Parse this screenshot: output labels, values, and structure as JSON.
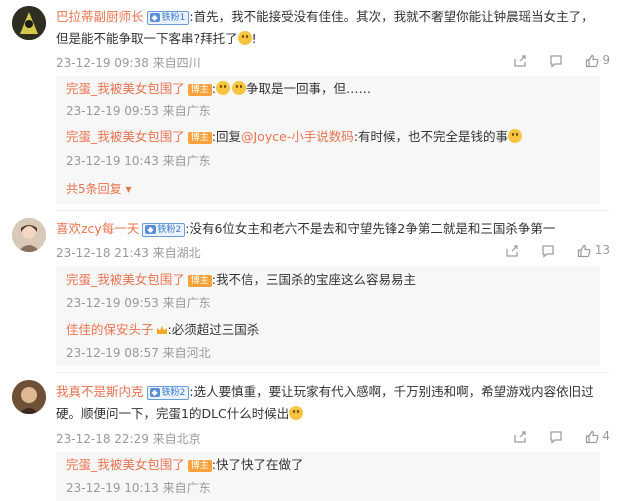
{
  "comments": [
    {
      "user": "巴拉蒂副厨师长",
      "badge": "铁粉1",
      "text": ":首先，我不能接受没有佳佳。其次，我就不奢望你能让钟晨瑶当女主了，",
      "text2": "但是能不能争取一下客串?拜托了",
      "text2_end": "!",
      "meta": "23-12-19 09:38 来自四川",
      "likes": "9",
      "replies": [
        {
          "user": "完蛋_我被美女包围了",
          "badge": "博主",
          "text_pre": ":",
          "text": "争取是一回事，但……",
          "meta": "23-12-19 09:53 来自广东"
        },
        {
          "user": "完蛋_我被美女包围了",
          "badge": "博主",
          "text_pre": ":回复",
          "mention": "@Joyce-小手说数码",
          "text": ":有时候，也不完全是钱的事",
          "meta": "23-12-19 10:43 来自广东"
        }
      ],
      "more": "共5条回复"
    },
    {
      "user": "喜欢zcy每一天",
      "badge": "铁粉2",
      "text": ":没有6位女主和老六不是去和守望先锋2争第二就是和三国杀争第一",
      "meta": "23-12-18 21:43 来自湖北",
      "likes": "13",
      "replies": [
        {
          "user": "完蛋_我被美女包围了",
          "badge": "博主",
          "text": ":我不信，三国杀的宝座这么容易易主",
          "meta": "23-12-19 09:53 来自广东"
        },
        {
          "user": "佳佳的保安头子",
          "badge": "",
          "text": ":必须超过三国杀",
          "meta": "23-12-19 08:57 来自河北"
        }
      ]
    },
    {
      "user": "我真不是斯内克",
      "badge": "铁粉2",
      "text": ":选人要慎重，要让玩家有代入感啊，千万别违和啊，希望游戏内容依旧过",
      "text2": "硬。顺便问一下，完蛋1的DLC什么时候出",
      "meta": "23-12-18 22:29 来自北京",
      "likes": "4",
      "replies": [
        {
          "user": "完蛋_我被美女包围了",
          "badge": "博主",
          "text": ":快了快了在做了",
          "meta": "23-12-19 10:13 来自广东"
        }
      ]
    }
  ],
  "icons": {
    "share": "share-icon",
    "comment": "comment-icon",
    "like": "like-icon"
  },
  "colors": {
    "username": "#eb7350",
    "meta": "#999999",
    "reply_bg": "#f7f7f7"
  }
}
